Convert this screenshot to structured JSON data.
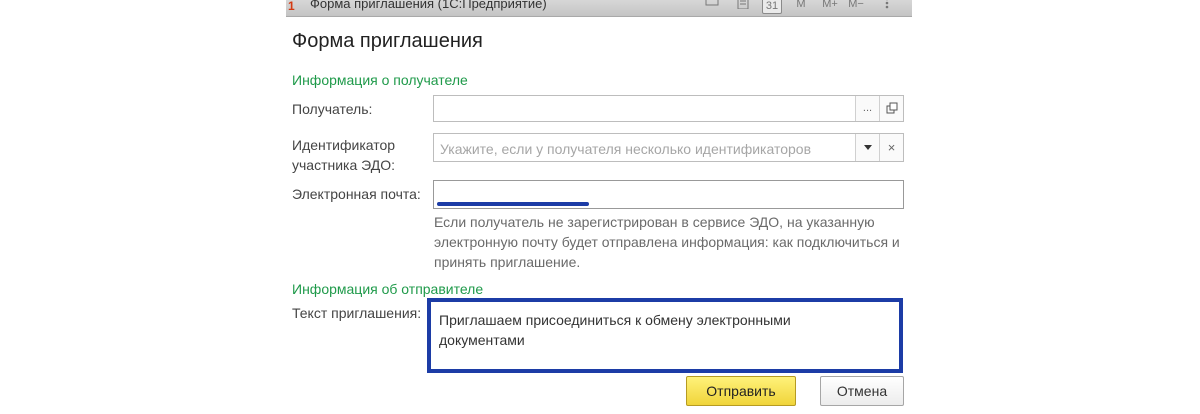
{
  "window": {
    "title": "Форма приглашения  (1С:Предприятие)",
    "toolbar": [
      "31",
      "M",
      "M+",
      "M−"
    ]
  },
  "form": {
    "title": "Форма приглашения",
    "recipient_section": "Информация о получателе",
    "recipient_label": "Получатель:",
    "recipient_value": "",
    "recipient_select_btn": "...",
    "edo_label_line1": "Идентификатор",
    "edo_label_line2": "участника ЭДО:",
    "edo_placeholder": "Укажите, если у получателя несколько идентификаторов",
    "email_label": "Электронная почта:",
    "email_value": "",
    "hint": "Если получатель не зарегистрирован в сервисе ЭДО, на указанную электронную почту будет отправлена информация: как подключиться и принять приглашение.",
    "sender_section": "Информация об отправителе",
    "invite_label": "Текст приглашения:",
    "invite_text": "Приглашаем присоединиться к обмену электронными документами"
  },
  "buttons": {
    "send": "Отправить",
    "cancel": "Отмена"
  },
  "colors": {
    "section": "#1f9a4a",
    "highlight_border": "#1c3ca6",
    "primary_button": "#f0d43a"
  }
}
